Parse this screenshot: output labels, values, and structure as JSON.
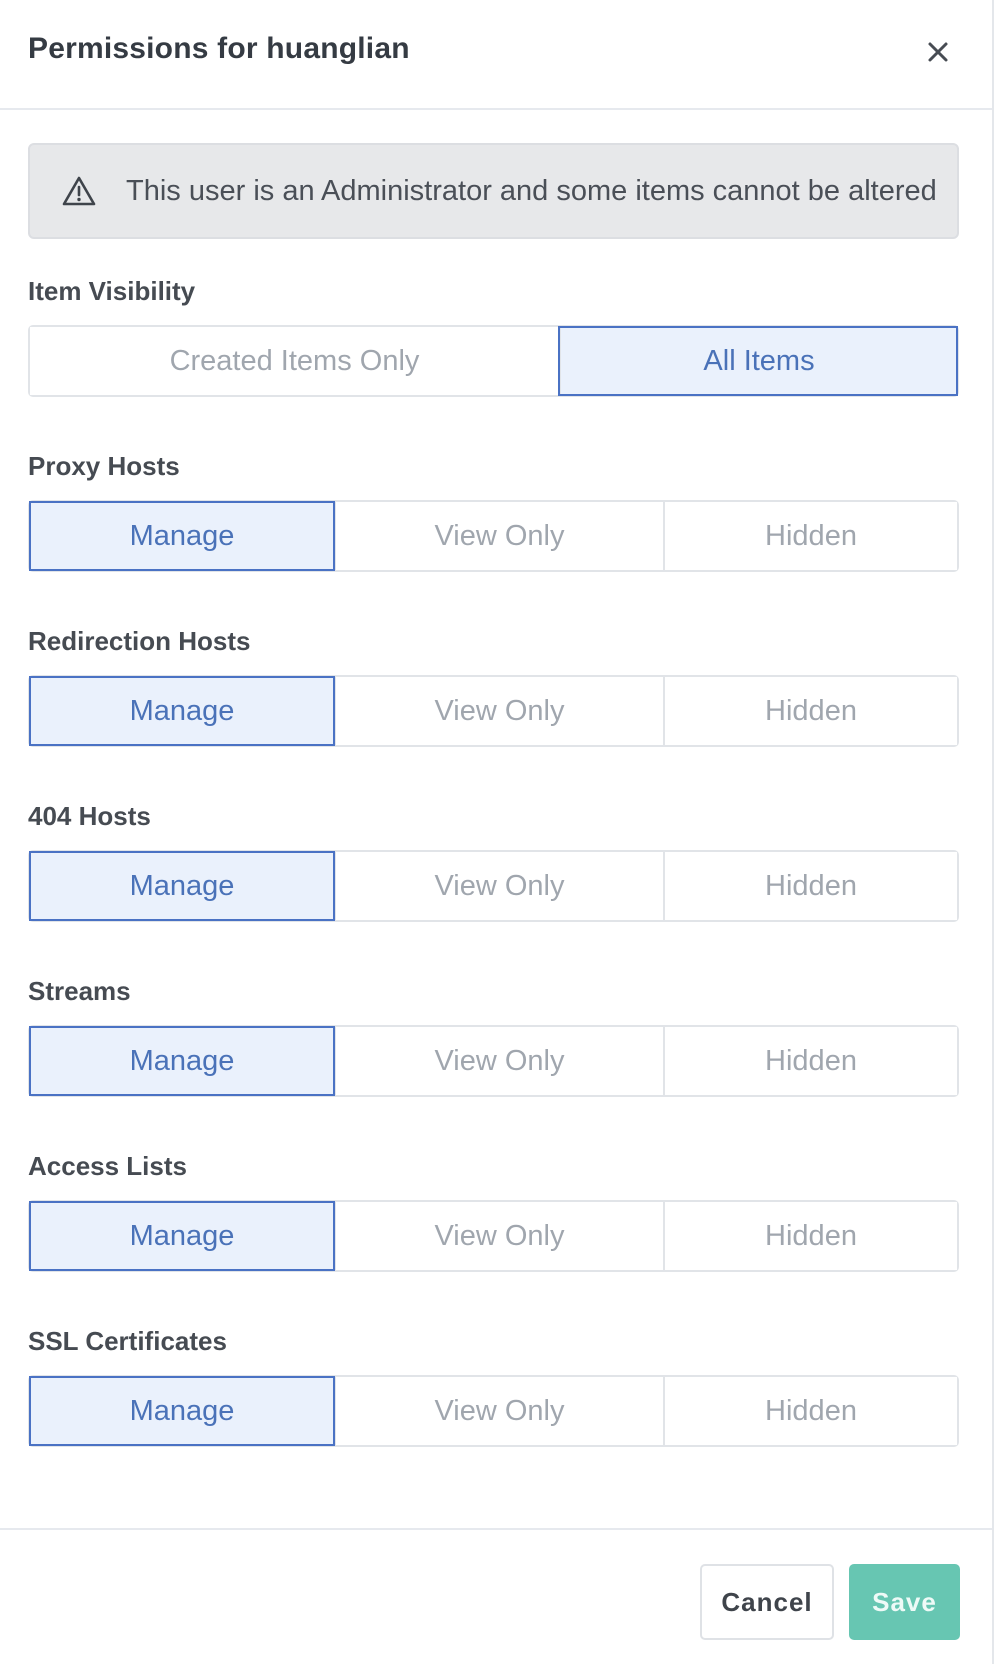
{
  "header": {
    "title": "Permissions for huanglian",
    "close_icon": "close-icon"
  },
  "alert": {
    "icon": "warning-triangle-icon",
    "text": "This user is an Administrator and some items cannot be altered"
  },
  "item_visibility": {
    "label": "Item Visibility",
    "options": [
      {
        "label": "Created Items Only",
        "active": false
      },
      {
        "label": "All Items",
        "active": true
      }
    ]
  },
  "sections": [
    {
      "label": "Proxy Hosts",
      "options": [
        "Manage",
        "View Only",
        "Hidden"
      ],
      "selected": "Manage"
    },
    {
      "label": "Redirection Hosts",
      "options": [
        "Manage",
        "View Only",
        "Hidden"
      ],
      "selected": "Manage"
    },
    {
      "label": "404 Hosts",
      "options": [
        "Manage",
        "View Only",
        "Hidden"
      ],
      "selected": "Manage"
    },
    {
      "label": "Streams",
      "options": [
        "Manage",
        "View Only",
        "Hidden"
      ],
      "selected": "Manage"
    },
    {
      "label": "Access Lists",
      "options": [
        "Manage",
        "View Only",
        "Hidden"
      ],
      "selected": "Manage"
    },
    {
      "label": "SSL Certificates",
      "options": [
        "Manage",
        "View Only",
        "Hidden"
      ],
      "selected": "Manage"
    }
  ],
  "footer": {
    "cancel_label": "Cancel",
    "save_label": "Save"
  },
  "colors": {
    "accent": "#4a72c4",
    "active_bg": "#eaf1fc",
    "save_bg": "#67c6b2",
    "alert_bg": "#e7e8ea"
  }
}
